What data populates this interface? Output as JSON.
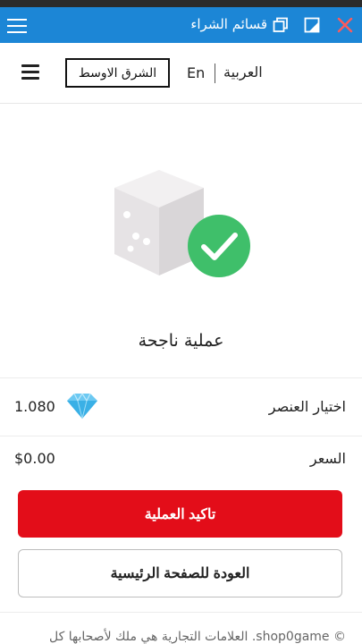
{
  "titlebar": {
    "title": "قسائم الشراء",
    "icons": [
      "menu-icon",
      "restore-icon",
      "resize-icon",
      "close-icon"
    ],
    "background": "#1c86d6"
  },
  "header": {
    "region": "الشرق الاوسط",
    "lang_en": "En",
    "lang_ar": "العربية"
  },
  "status": {
    "message": "عملية ناجحة",
    "hero_icon": "dice-with-check-icon",
    "check_color": "#3fbf6a"
  },
  "details": {
    "item_label": "اختيار العنصر",
    "item_value": "1.080",
    "item_icon": "diamond-icon",
    "price_label": "السعر",
    "price_value": "$0.00"
  },
  "actions": {
    "confirm_label": "تاكيد العملية",
    "confirm_color": "#e30d19",
    "home_label": "العودة للصفحة الرئيسية"
  },
  "footer": {
    "text": "© shop0game. العلامات التجارية هي ملك لأصحابها كل"
  }
}
